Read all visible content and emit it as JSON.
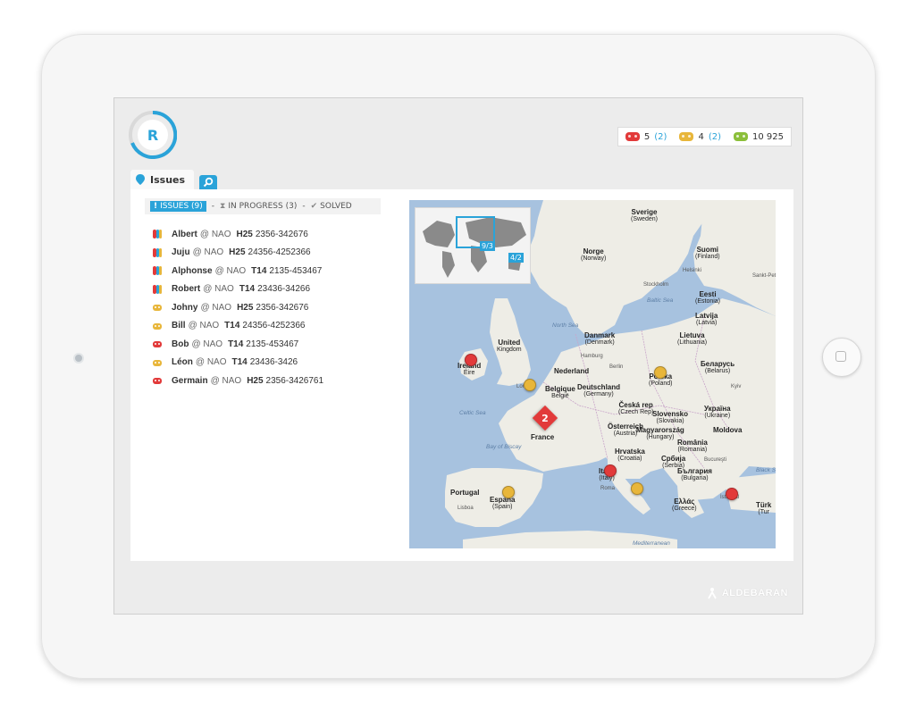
{
  "stats": [
    {
      "color": "#e23a3a",
      "value": "5",
      "paren": "(2)"
    },
    {
      "color": "#e8b63a",
      "value": "4",
      "paren": "(2)"
    },
    {
      "color": "#8bbf3a",
      "value": "10 925",
      "paren": ""
    }
  ],
  "tabs": {
    "issues_label": "Issues"
  },
  "filters": {
    "issues": "ISSUES (9)",
    "sep1": "-",
    "in_progress": "IN PROGRESS (3)",
    "sep2": "-",
    "solved": "SOLVED"
  },
  "issues": [
    {
      "name": "Albert",
      "at": "@ NAO",
      "robot": "H25",
      "code": "2356-342676",
      "status": "multi"
    },
    {
      "name": "Juju",
      "at": "@ NAO",
      "robot": "H25",
      "code": "24356-4252366",
      "status": "multi"
    },
    {
      "name": "Alphonse",
      "at": "@ NAO",
      "robot": "T14",
      "code": "2135-453467",
      "status": "multi"
    },
    {
      "name": "Robert",
      "at": "@ NAO",
      "robot": "T14",
      "code": "23436-34266",
      "status": "multi"
    },
    {
      "name": "Johny",
      "at": "@ NAO",
      "robot": "H25",
      "code": "2356-342676",
      "status": "yellow"
    },
    {
      "name": "Bill",
      "at": "@ NAO",
      "robot": "T14",
      "code": "24356-4252366",
      "status": "yellow"
    },
    {
      "name": "Bob",
      "at": "@ NAO",
      "robot": "T14",
      "code": "2135-453467",
      "status": "red"
    },
    {
      "name": "Léon",
      "at": "@ NAO",
      "robot": "T14",
      "code": "23436-3426",
      "status": "yellow"
    },
    {
      "name": "Germain",
      "at": "@ NAO",
      "robot": "H25",
      "code": "2356-3426761",
      "status": "red"
    }
  ],
  "map": {
    "minimap": {
      "badge1": "9/3",
      "badge2": "4/2"
    },
    "cluster_count": "2",
    "labels": [
      {
        "t": "Sverige",
        "s": "(Sweden)"
      },
      {
        "t": "Norge",
        "s": "(Norway)"
      },
      {
        "t": "Suomi",
        "s": "(Finland)"
      },
      {
        "t": "United",
        "s": "Kingdom"
      },
      {
        "t": "Ireland",
        "s": "Éire"
      },
      {
        "t": "Eesti",
        "s": "(Estonia)"
      },
      {
        "t": "Latvija",
        "s": "(Latvia)"
      },
      {
        "t": "Lietuva",
        "s": "(Lithuania)"
      },
      {
        "t": "Danmark",
        "s": "(Denmark)"
      },
      {
        "t": "Беларусь",
        "s": "(Belarus)"
      },
      {
        "t": "Nederland",
        "s": ""
      },
      {
        "t": "Polska",
        "s": "(Poland)"
      },
      {
        "t": "Belgique",
        "s": "België"
      },
      {
        "t": "Deutschland",
        "s": "(Germany)"
      },
      {
        "t": "Україна",
        "s": "(Ukraine)"
      },
      {
        "t": "Česká rep",
        "s": "(Czech Rep)"
      },
      {
        "t": "Slovensko",
        "s": "(Slovakia)"
      },
      {
        "t": "France",
        "s": ""
      },
      {
        "t": "Österreich",
        "s": "(Austria)"
      },
      {
        "t": "Magyarország",
        "s": "(Hungary)"
      },
      {
        "t": "Moldova",
        "s": ""
      },
      {
        "t": "România",
        "s": "(Romania)"
      },
      {
        "t": "Hrvatska",
        "s": "(Croatia)"
      },
      {
        "t": "Србија",
        "s": "(Serbia)"
      },
      {
        "t": "България",
        "s": "(Bulgaria)"
      },
      {
        "t": "Portugal",
        "s": ""
      },
      {
        "t": "España",
        "s": "(Spain)"
      },
      {
        "t": "Italia",
        "s": "(Italy)"
      },
      {
        "t": "Ελλάς",
        "s": "(Greece)"
      },
      {
        "t": "Türk",
        "s": "(Tur"
      }
    ],
    "seas": [
      "North Sea",
      "Baltic Sea",
      "Celtic Sea",
      "Bay of Biscay",
      "Black Se",
      "Mediterranean"
    ],
    "cities": [
      "Stockholm",
      "Helsinki",
      "Sankt-Peter",
      "Hamburg",
      "Berlin",
      "London",
      "Kyiv",
      "Bucureşti",
      "Roma",
      "Lisboa",
      "İstanbul"
    ]
  },
  "brand": "ALDEBARAN"
}
